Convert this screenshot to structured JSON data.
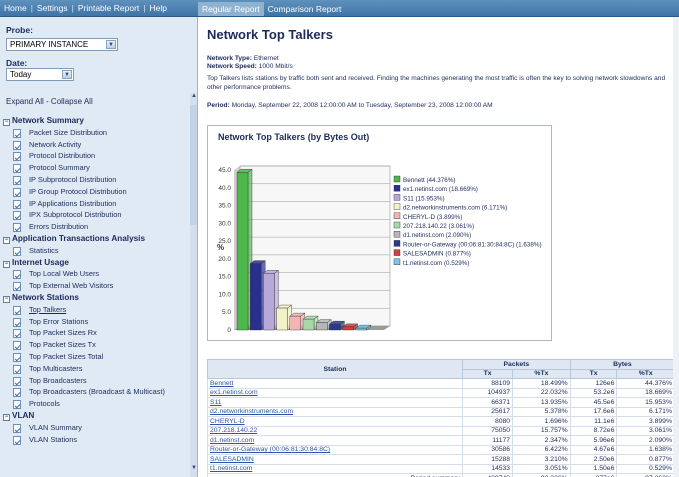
{
  "top_nav": [
    "Home",
    "Settings",
    "Printable Report",
    "Help"
  ],
  "tabs": [
    {
      "label": "Regular Report",
      "active": true
    },
    {
      "label": "Comparison Report",
      "active": false
    }
  ],
  "sidebar": {
    "probe_label": "Probe:",
    "probe_value": "PRIMARY INSTANCE",
    "date_label": "Date:",
    "date_value": "Today",
    "expand_collapse": "Expand All - Collapse All",
    "categories": [
      {
        "label": "Network Summary",
        "items": [
          "Packet Size Distribution",
          "Network Activity",
          "Protocol Distribution",
          "Protocol Summary",
          "IP Subprotocol Distribution",
          "IP Group Protocol Distribution",
          "IP Applications Distribution",
          "IPX Subprotocol Distribution",
          "Errors Distribution"
        ]
      },
      {
        "label": "Application Transactions Analysis",
        "items": [
          "Statistics"
        ]
      },
      {
        "label": "Internet Usage",
        "items": [
          "Top Local Web Users",
          "Top External Web Visitors"
        ]
      },
      {
        "label": "Network Stations",
        "items": [
          "Top Talkers",
          "Top Error Stations",
          "Top Packet Sizes Rx",
          "Top Packet Sizes Tx",
          "Top Packet Sizes Total",
          "Top Multicasters",
          "Top Broadcasters",
          "Top Broadcasters (Broadcast & Multicast)",
          "Protocols"
        ]
      },
      {
        "label": "VLAN",
        "items": [
          "VLAN Summary",
          "VLAN Stations"
        ]
      }
    ],
    "current_item": "Top Talkers"
  },
  "main": {
    "title": "Network Top Talkers",
    "network_type_label": "Network Type:",
    "network_type": "Ethernet",
    "network_speed_label": "Network Speed:",
    "network_speed": "1000 Mbit/s",
    "description": "Top Talkers lists stations by traffic both sent and received. Finding the machines generating the most traffic is often the key to solving network slowdowns and other performance problems.",
    "period_label": "Period:",
    "period": "Monday, September 22, 2008 12:00:00 AM to Tuesday, September 23, 2008 12:00:00 AM"
  },
  "chart_data": {
    "type": "bar",
    "title": "Network Top Talkers (by Bytes Out)",
    "ylabel": "%",
    "ylim": [
      0,
      45
    ],
    "yticks": [
      "0",
      "5.0",
      "10.0",
      "15.0",
      "20.0",
      "25.0",
      "30.0",
      "35.0",
      "40.0",
      "45.0"
    ],
    "categories": [
      "Bennett",
      "ex1.netinst.com",
      "S11",
      "d2.networkinstruments.com",
      "CHERYL-D",
      "207.218.140.22",
      "d1.netinst.com",
      "Router-or-Gateway (00:06:81:30:84:8C)",
      "SALESADMIN",
      "t1.netinst.com"
    ],
    "values": [
      44.376,
      18.669,
      15.953,
      6.171,
      3.899,
      3.061,
      2.09,
      1.638,
      0.877,
      0.529
    ],
    "colors": [
      "#4cb84c",
      "#2a2f8c",
      "#b6a8d8",
      "#f2f2c8",
      "#f4b4b4",
      "#a8d8a8",
      "#b6b6b6",
      "#2a3a8c",
      "#d04040",
      "#7cc4e4"
    ],
    "legend": [
      "Bennett (44.376%)",
      "ex1.netinst.com (18.669%)",
      "S11 (15.953%)",
      "d2.networkinstruments.com (6.171%)",
      "CHERYL-D (3.899%)",
      "207.218.140.22 (3.061%)",
      "d1.netinst.com (2.090%)",
      "Router-or-Gateway (00:06:81:30:84:8C) (1.638%)",
      "SALESADMIN (0.877%)",
      "t1.netinst.com (0.529%)"
    ],
    "legend_position": "right"
  },
  "table": {
    "station_header": "Station",
    "packets_header": "Packets",
    "bytes_header": "Bytes",
    "sub_headers": [
      "Tx",
      "%Tx",
      "Tx",
      "%Tx"
    ],
    "rows": [
      {
        "station": "Bennett",
        "pkt_tx": "88109",
        "pkt_pct": "18.499%",
        "byte_tx": "126e6",
        "byte_pct": "44.376%"
      },
      {
        "station": "ex1.netinst.com",
        "pkt_tx": "104937",
        "pkt_pct": "22.032%",
        "byte_tx": "53.2e6",
        "byte_pct": "18.669%"
      },
      {
        "station": "S11",
        "pkt_tx": "66371",
        "pkt_pct": "13.935%",
        "byte_tx": "45.5e6",
        "byte_pct": "15.953%"
      },
      {
        "station": "d2.networkinstruments.com",
        "pkt_tx": "25617",
        "pkt_pct": "5.378%",
        "byte_tx": "17.6e6",
        "byte_pct": "6.171%"
      },
      {
        "station": "CHERYL-D",
        "pkt_tx": "8080",
        "pkt_pct": "1.696%",
        "byte_tx": "11.1e6",
        "byte_pct": "3.899%"
      },
      {
        "station": "207.218.140.22",
        "pkt_tx": "75050",
        "pkt_pct": "15.757%",
        "byte_tx": "8.72e6",
        "byte_pct": "3.061%"
      },
      {
        "station": "d1.netinst.com",
        "pkt_tx": "11177",
        "pkt_pct": "2.347%",
        "byte_tx": "5.96e6",
        "byte_pct": "2.090%"
      },
      {
        "station": "Router-or-Gateway (00:06:81:30:84:8C)",
        "pkt_tx": "30586",
        "pkt_pct": "6.422%",
        "byte_tx": "4.67e6",
        "byte_pct": "1.638%"
      },
      {
        "station": "SALESADMIN",
        "pkt_tx": "15288",
        "pkt_pct": "3.210%",
        "byte_tx": "2.50e6",
        "byte_pct": "0.877%"
      },
      {
        "station": "t1.netinst.com",
        "pkt_tx": "14533",
        "pkt_pct": "3.051%",
        "byte_tx": "1.50e6",
        "byte_pct": "0.529%"
      }
    ],
    "summary": {
      "label": "Period summary",
      "pkt_tx": "439748",
      "pkt_pct": "92.326%",
      "byte_tx": "277e6",
      "byte_pct": "97.262%"
    }
  }
}
